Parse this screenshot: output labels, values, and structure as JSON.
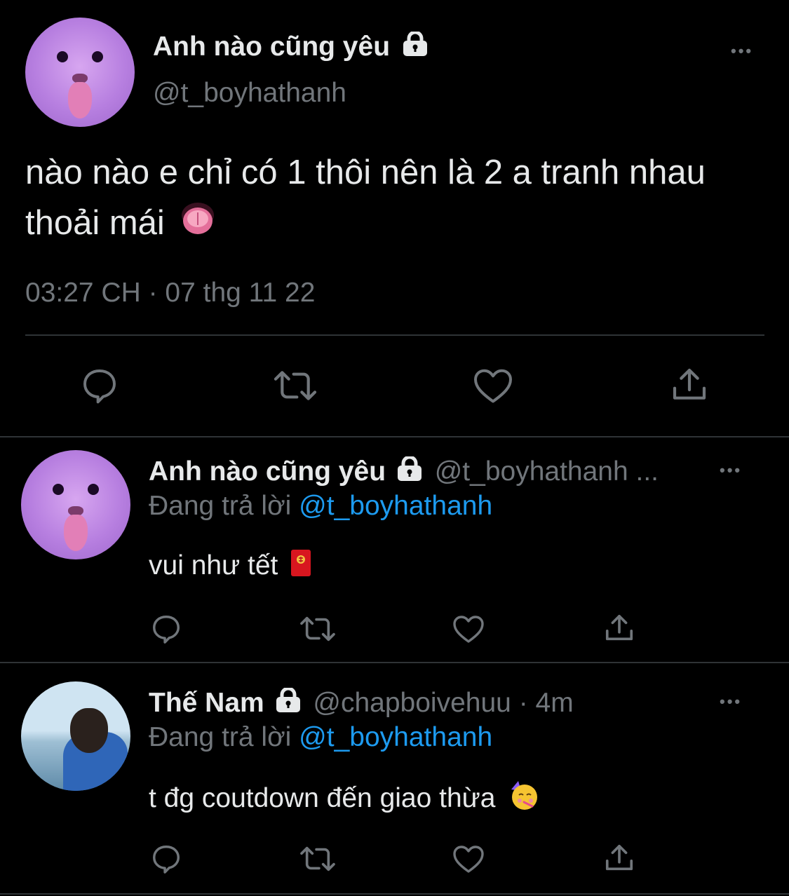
{
  "main_tweet": {
    "display_name": "Anh nào cũng yêu",
    "handle": "@t_boyhathanh",
    "text": "nào nào e chỉ có 1 thôi nên là 2 a tranh nhau thoải mái",
    "emoji_icon": "tongue-face",
    "timestamp": "03:27 CH · 07 thg 11 22"
  },
  "replies": [
    {
      "display_name": "Anh nào cũng yêu",
      "handle": "@t_boyhathanh ...",
      "replying_prefix": "Đang trả lời",
      "replying_to": "@t_boyhathanh",
      "text": "vui như tết",
      "emoji_icon": "red-envelope"
    },
    {
      "display_name": "Thế Nam",
      "handle": "@chapboivehuu · 4m",
      "replying_prefix": "Đang trả lời",
      "replying_to": "@t_boyhathanh",
      "text": "t đg coutdown đến giao thừa",
      "emoji_icon": "partying-face"
    }
  ],
  "icons": {
    "more": "•••",
    "lock": "lock-icon",
    "reply": "reply-icon",
    "retweet": "retweet-icon",
    "like": "heart-icon",
    "share": "share-icon"
  },
  "colors": {
    "background": "#000000",
    "text": "#e7e9ea",
    "muted": "#71767b",
    "link": "#1d9bf0",
    "divider": "#2f3336"
  }
}
